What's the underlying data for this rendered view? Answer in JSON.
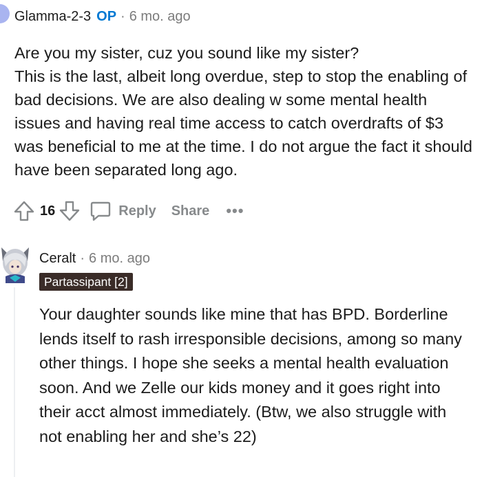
{
  "parent_comment": {
    "author": "Glamma-2-3",
    "op_badge": "OP",
    "separator": "·",
    "time": "6 mo. ago",
    "avatar_color": "#a9b4f0",
    "body_lines": [
      "Are you my sister, cuz you sound like my sister?",
      "This is the last, albeit long overdue, step to stop the enabling of bad decisions. We are also dealing w some mental health issues and having real time access to catch overdrafts of $3 was beneficial to me at the time. I do not argue the fact it should have been separated long ago."
    ],
    "actions": {
      "upvote_icon": "arrow-up-icon",
      "vote_count": "16",
      "downvote_icon": "arrow-down-icon",
      "reply_icon": "comment-bubble-icon",
      "reply_label": "Reply",
      "share_label": "Share",
      "more_label": "•••"
    }
  },
  "child_comment": {
    "author": "Ceralt",
    "separator": "·",
    "time": "6 mo. ago",
    "flair": "Partassipant [2]",
    "flair_color": "#3a2c28",
    "body": "Your daughter sounds like mine that has BPD. Borderline lends itself to rash irresponsible decisions, among so many other things. I hope she seeks a mental health evaluation soon. And we Zelle our kids money and it goes right into their acct almost immediately. (Btw, we also struggle with not enabling her and she’s 22)"
  },
  "colors": {
    "op_blue": "#0079d3",
    "meta_gray": "#7c7c7c",
    "action_gray": "#878a8c",
    "text": "#1c1c1c"
  }
}
